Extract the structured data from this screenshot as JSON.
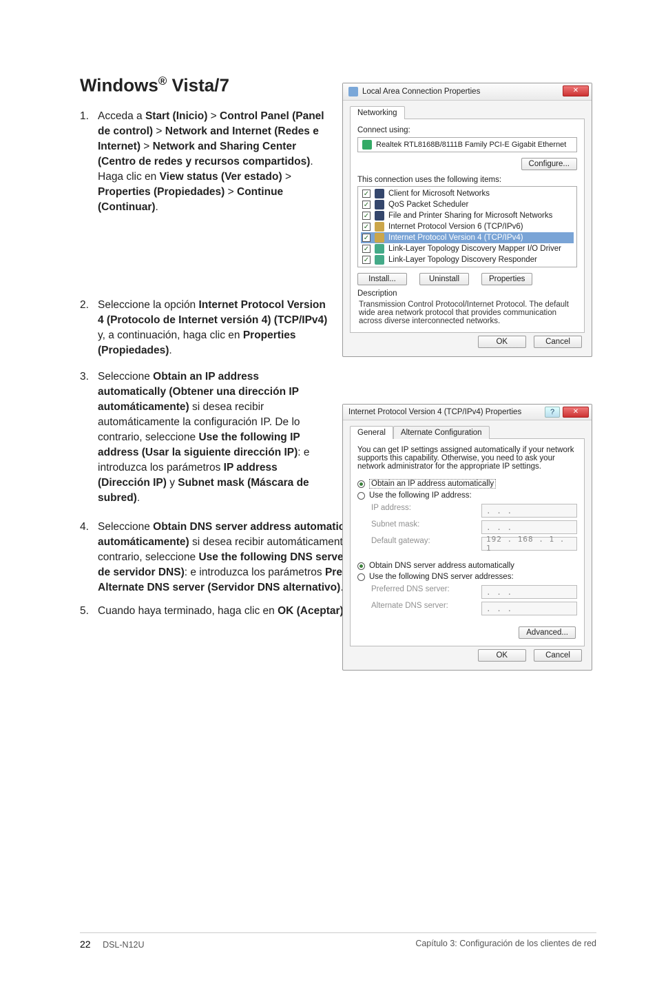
{
  "heading": {
    "prefix": "Windows",
    "reg": "®",
    "suffix": " Vista/7"
  },
  "steps": {
    "s1": {
      "num": "1.",
      "t1": "Acceda a ",
      "b1": "Start (Inicio)",
      "t2": " > ",
      "b2": "Control Panel (Panel de control)",
      "t3": " > ",
      "b3": "Network and Internet (Redes e Internet)",
      "t4": " > ",
      "b4": "Network and Sharing Center (Centro de redes y recursos compartidos)",
      "t5": ". Haga clic en ",
      "b5": "View status (Ver estado)",
      "t6": " > ",
      "b6": "Properties (Propiedades)",
      "t7": " > ",
      "b7": "Continue (Continuar)",
      "t8": "."
    },
    "s2": {
      "num": "2.",
      "t1": "Seleccione la opción ",
      "b1": "Internet Protocol Version 4 (Protocolo de Internet versión 4) (TCP/IPv4)",
      "t2": " y, a continuación, haga clic en ",
      "b2": "Properties (Propiedades)",
      "t3": "."
    },
    "s3": {
      "num": "3.",
      "t1": "Seleccione ",
      "b1": "Obtain an IP address automatically (Obtener una dirección IP automáticamente)",
      "t2": " si desea recibir automáticamente la configuración IP. De lo contrario, seleccione ",
      "b2": "Use the following IP address (Usar la siguiente dirección IP)",
      "t3": ": e introduzca los parámetros ",
      "b3": "IP address (Dirección IP)",
      "t4": " y ",
      "b4": "Subnet mask (Máscara de subred)",
      "t5": "."
    },
    "s4": {
      "num": "4.",
      "t1": "Seleccione ",
      "b1": "Obtain DNS server address automatically (Obtener la dirección del servidor DNS automáticamente)",
      "t2": " si desea recibir automáticamente la configuración de los servidores DNS. De lo contrario, seleccione ",
      "b2": "Use the following DNS server addresses (Usar las siguientes direcciones de servidor DNS)",
      "t3": ": e introduzca los parámetros ",
      "b3": "Preferred DNS server (Servidor DNS preferido)",
      "t4": " y ",
      "b4": "Alternate DNS server (Servidor DNS alternativo)",
      "t5": "."
    },
    "s5": {
      "num": "5.",
      "t1": "Cuando haya terminado, haga clic en ",
      "b1": "OK (Aceptar).",
      "t2": ""
    }
  },
  "dlg1": {
    "title": "Local Area Connection Properties",
    "tab": "Networking",
    "connect_using": "Connect using:",
    "adapter": "Realtek RTL8168B/8111B Family PCI-E Gigabit Ethernet",
    "configure": "Configure...",
    "uses_items": "This connection uses the following items:",
    "items": [
      "Client for Microsoft Networks",
      "QoS Packet Scheduler",
      "File and Printer Sharing for Microsoft Networks",
      "Internet Protocol Version 6 (TCP/IPv6)",
      "Internet Protocol Version 4 (TCP/IPv4)",
      "Link-Layer Topology Discovery Mapper I/O Driver",
      "Link-Layer Topology Discovery Responder"
    ],
    "install": "Install...",
    "uninstall": "Uninstall",
    "properties": "Properties",
    "description_label": "Description",
    "description_text": "Transmission Control Protocol/Internet Protocol. The default wide area network protocol that provides communication across diverse interconnected networks.",
    "ok": "OK",
    "cancel": "Cancel"
  },
  "dlg2": {
    "title": "Internet Protocol Version 4 (TCP/IPv4) Properties",
    "tab_general": "General",
    "tab_alt": "Alternate Configuration",
    "intro": "You can get IP settings assigned automatically if your network supports this capability. Otherwise, you need to ask your network administrator for the appropriate IP settings.",
    "r_obtain_ip": "Obtain an IP address automatically",
    "r_use_ip": "Use the following IP address:",
    "ip_address": "IP address:",
    "subnet": "Subnet mask:",
    "gateway": "Default gateway:",
    "gateway_val": "192 . 168 .  1  .  1",
    "dots": ".       .       .",
    "r_obtain_dns": "Obtain DNS server address automatically",
    "r_use_dns": "Use the following DNS server addresses:",
    "pref_dns": "Preferred DNS server:",
    "alt_dns": "Alternate DNS server:",
    "advanced": "Advanced...",
    "ok": "OK",
    "cancel": "Cancel"
  },
  "footer": {
    "page": "22",
    "model": "DSL-N12U",
    "chapter": "Capítulo 3: Configuración de los clientes de red"
  }
}
